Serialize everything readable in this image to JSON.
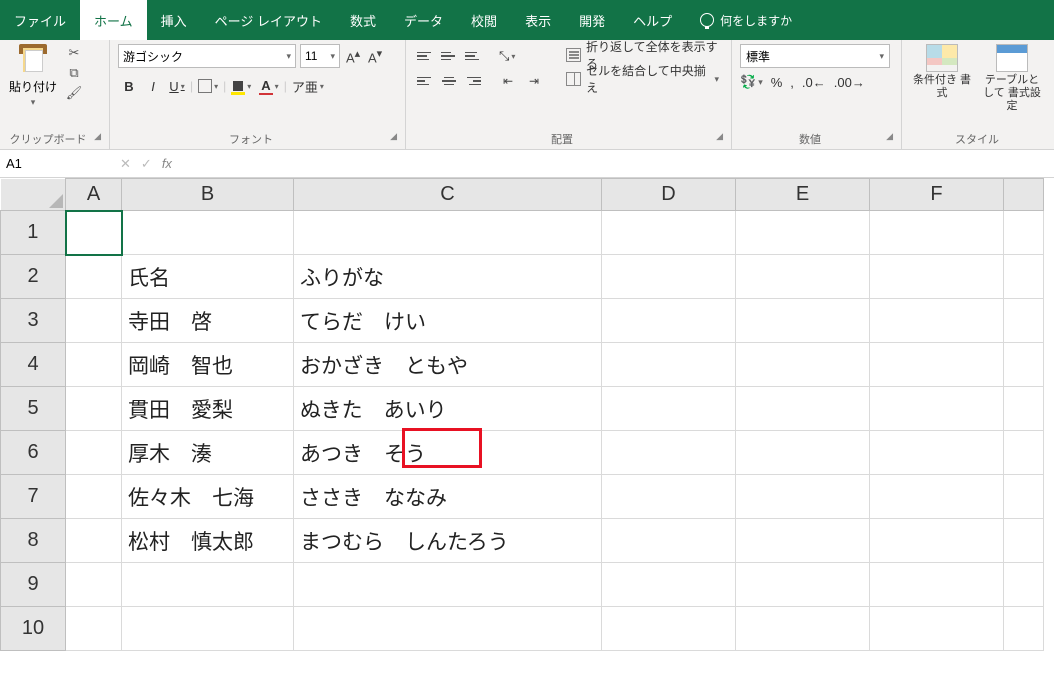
{
  "tabs": {
    "file": "ファイル",
    "home": "ホーム",
    "insert": "挿入",
    "page_layout": "ページ レイアウト",
    "formulas": "数式",
    "data": "データ",
    "review": "校閲",
    "view": "表示",
    "developer": "開発",
    "help": "ヘルプ",
    "tell_me": "何をしますか"
  },
  "ribbon": {
    "clipboard": {
      "paste": "貼り付け",
      "label": "クリップボード"
    },
    "font": {
      "name": "游ゴシック",
      "size": "11",
      "bold": "B",
      "italic": "I",
      "underline": "U",
      "label": "フォント",
      "ruby": "ア亜"
    },
    "alignment": {
      "wrap": "折り返して全体を表示する",
      "merge": "セルを結合して中央揃え",
      "label": "配置"
    },
    "number": {
      "format": "標準",
      "label": "数値"
    },
    "styles": {
      "conditional": "条件付き\n書式",
      "table_format": "テーブルとして\n書式設定",
      "label": "スタイル"
    }
  },
  "formula_bar": {
    "name_box": "A1",
    "fx": "fx",
    "formula": ""
  },
  "grid": {
    "columns": [
      "A",
      "B",
      "C",
      "D",
      "E",
      "F"
    ],
    "rows": [
      {
        "n": "1",
        "b": "",
        "c": ""
      },
      {
        "n": "2",
        "b": "氏名",
        "c": "ふりがな"
      },
      {
        "n": "3",
        "b": "寺田　啓",
        "c": "てらだ　けい"
      },
      {
        "n": "4",
        "b": "岡崎　智也",
        "c": "おかざき　ともや"
      },
      {
        "n": "5",
        "b": "貫田　愛梨",
        "c": "ぬきた　あいり"
      },
      {
        "n": "6",
        "b": "厚木　湊",
        "c": "あつき　そう"
      },
      {
        "n": "7",
        "b": "佐々木　七海",
        "c": "ささき　ななみ"
      },
      {
        "n": "8",
        "b": "松村　慎太郎",
        "c": "まつむら　しんたろう"
      },
      {
        "n": "9",
        "b": "",
        "c": ""
      },
      {
        "n": "10",
        "b": "",
        "c": ""
      }
    ]
  }
}
